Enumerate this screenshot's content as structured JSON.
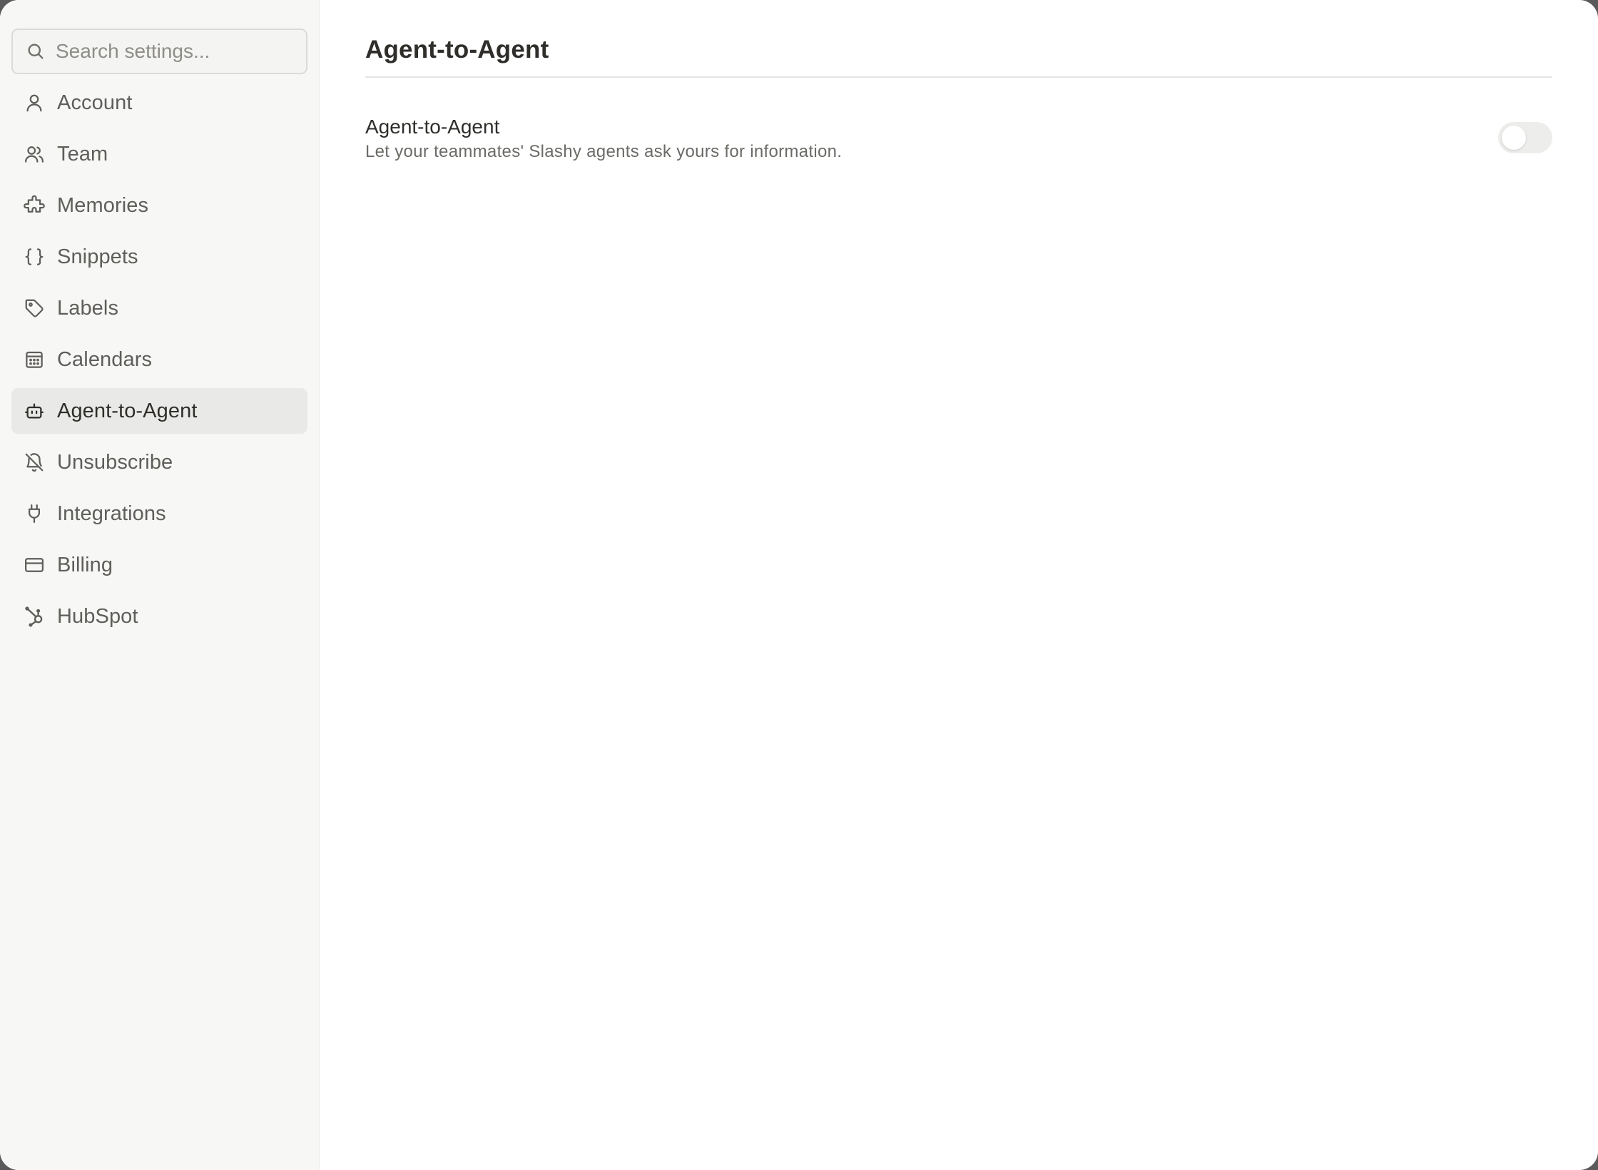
{
  "search": {
    "placeholder": "Search settings..."
  },
  "sidebar": {
    "items": [
      {
        "label": "Account",
        "icon": "user-icon",
        "active": false
      },
      {
        "label": "Team",
        "icon": "users-icon",
        "active": false
      },
      {
        "label": "Memories",
        "icon": "puzzle-icon",
        "active": false
      },
      {
        "label": "Snippets",
        "icon": "braces-icon",
        "active": false
      },
      {
        "label": "Labels",
        "icon": "tag-icon",
        "active": false
      },
      {
        "label": "Calendars",
        "icon": "calendar-icon",
        "active": false
      },
      {
        "label": "Agent-to-Agent",
        "icon": "bot-icon",
        "active": true
      },
      {
        "label": "Unsubscribe",
        "icon": "bell-off-icon",
        "active": false
      },
      {
        "label": "Integrations",
        "icon": "plug-icon",
        "active": false
      },
      {
        "label": "Billing",
        "icon": "credit-card-icon",
        "active": false
      },
      {
        "label": "HubSpot",
        "icon": "hubspot-icon",
        "active": false
      }
    ]
  },
  "main": {
    "title": "Agent-to-Agent",
    "setting": {
      "title": "Agent-to-Agent",
      "description": "Let your teammates' Slashy agents ask yours for information.",
      "enabled": false
    }
  },
  "colors": {
    "sidebar_bg": "#f7f7f5",
    "active_item_bg": "#e9e9e7",
    "toggle_off": "#ededeb",
    "text_primary": "#2f2e2b",
    "text_secondary": "#5f5e5b"
  }
}
